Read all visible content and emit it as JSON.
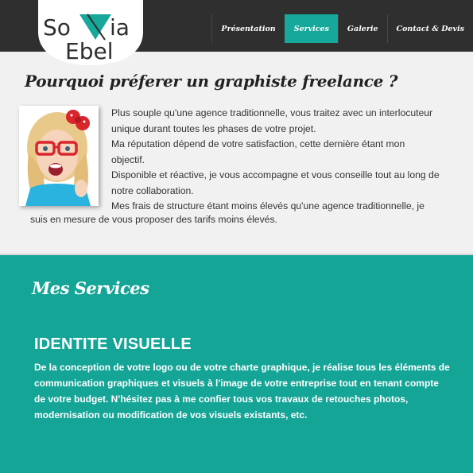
{
  "brand": {
    "logo_text": "Sonia Ebel",
    "colors": {
      "header_bg": "#2f2f2f",
      "accent": "#16a89a",
      "section_bg": "#f1f1f1"
    }
  },
  "nav": {
    "items": [
      {
        "label": "Présentation",
        "active": false
      },
      {
        "label": "Services",
        "active": true
      },
      {
        "label": "Galerie",
        "active": false
      },
      {
        "label": "Contact & Devis",
        "active": false
      }
    ]
  },
  "intro": {
    "title": "Pourquoi préferer un graphiste freelance ?",
    "photo_icon": "woman-with-red-glasses-photo",
    "lines": [
      "Plus souple qu'une agence traditionnelle, vous traitez avec un interlocuteur",
      "unique durant toutes les phases de votre projet.",
      "Ma réputation dépend de votre satisfaction, cette dernière étant mon",
      "objectif.",
      "Disponible et réactive, je vous accompagne et vous conseille tout au long de",
      "notre collaboration.",
      "Mes frais de structure étant moins élevés qu'une agence traditionnelle, je"
    ],
    "tail": "suis en mesure de vous proposer des tarifs moins élevés."
  },
  "services": {
    "title": "Mes Services",
    "heading": "IDENTITE VISUELLE",
    "lines": [
      "De la conception de votre logo ou de votre charte graphique, je réalise tous les éléments de",
      "communication graphiques et visuels à l'image de votre entreprise tout en tenant compte",
      "de votre budget. N'hésitez pas à me confier tous vos travaux de retouches photos,",
      "modernisation ou modification de vos visuels existants, etc."
    ]
  }
}
